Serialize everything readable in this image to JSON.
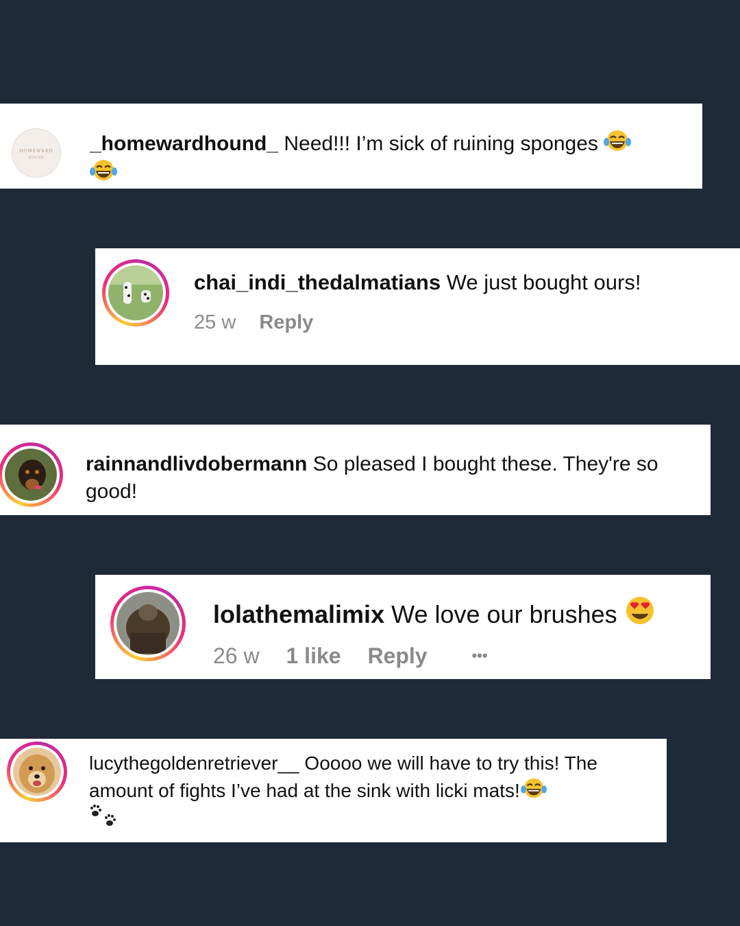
{
  "comments": [
    {
      "username": "_homewardhound_",
      "text": "Need!!! I’m sick of ruining sponges",
      "emoji": "laughing-tears",
      "avatar_label": "HOMEWARD",
      "avatar_sub": "HOUND"
    },
    {
      "username": "chai_indi_thedalmatians",
      "text": "We just bought ours!",
      "time": "25 w",
      "reply": "Reply"
    },
    {
      "username": "rainnandlivdobermann",
      "text": "So pleased I bought these. They're so good!"
    },
    {
      "username": "lolathemalimix",
      "text": "We love our brushes",
      "emoji": "heart-eyes",
      "time": "26 w",
      "likes": "1 like",
      "reply": "Reply",
      "more": "•••"
    },
    {
      "username": "lucythegoldenretriever__",
      "text": "Ooooo we will have to try this! The amount of fights I’ve had at the sink with licki mats!",
      "emoji": "laughing-tears",
      "emoji2": "paw-prints"
    }
  ],
  "colors": {
    "background": "#1e2a38",
    "card": "#ffffff",
    "meta": "#8a8a8a",
    "ring_gradient": [
      "#f9ce34",
      "#ee2a7b",
      "#c32aa3"
    ]
  }
}
